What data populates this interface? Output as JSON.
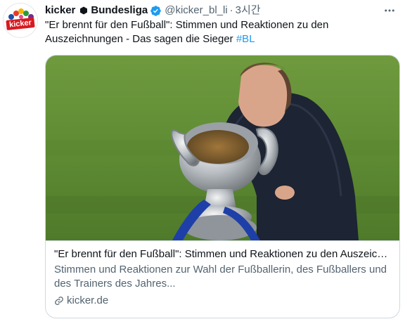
{
  "tweet": {
    "author_name": "kicker",
    "league": "Bundesliga",
    "handle": "@kicker_bl_li",
    "separator": "·",
    "time": "3시간",
    "text": "\"Er brennt für den Fußball\": Stimmen und Reaktionen zu den Auszeichnungen - Das sagen die Sieger ",
    "hashtag": "#BL"
  },
  "avatar": {
    "brand": "kicker"
  },
  "card": {
    "title": "\"Er brennt für den Fußball\": Stimmen und Reaktionen zu den Auszeichn...",
    "description": "Stimmen und Reaktionen zur Wahl der Fußballerin, des Fußballers und des Trainers des Jahres...",
    "domain": "kicker.de"
  },
  "icons": {
    "more": "more-horizontal-icon",
    "verified": "verified-badge-icon",
    "link": "link-icon",
    "hexagon": "hexagon-icon"
  },
  "colors": {
    "accent": "#1d9bf0",
    "text": "#0f1419",
    "secondary": "#536471",
    "border": "#cfd9de",
    "brand_red": "#d7191f"
  }
}
